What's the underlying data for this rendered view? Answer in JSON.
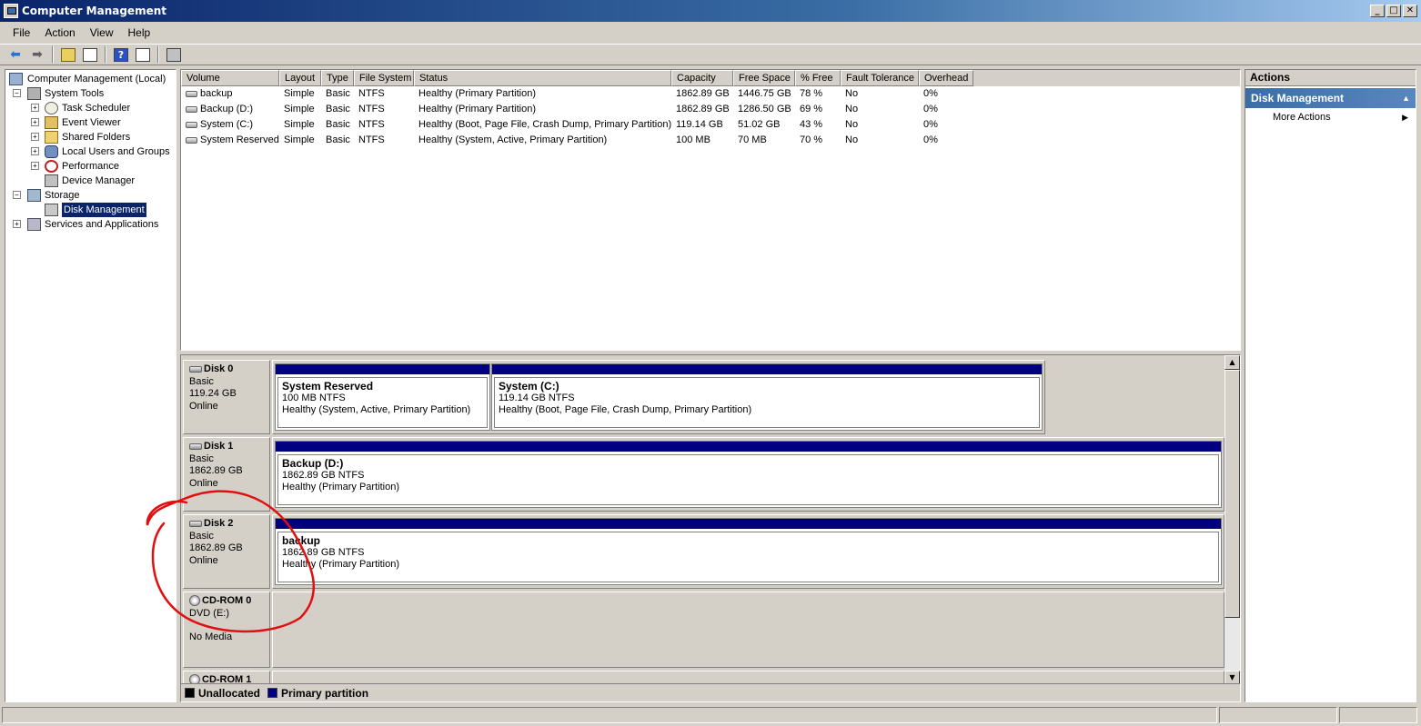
{
  "window": {
    "title": "Computer Management",
    "minimize": "_",
    "maximize": "□",
    "close": "✕"
  },
  "menu": [
    {
      "label": "File",
      "name": "file"
    },
    {
      "label": "Action",
      "name": "action"
    },
    {
      "label": "View",
      "name": "view"
    },
    {
      "label": "Help",
      "name": "help"
    }
  ],
  "tree": {
    "root": "Computer Management (Local)",
    "system_tools": "System Tools",
    "task_scheduler": "Task Scheduler",
    "event_viewer": "Event Viewer",
    "shared_folders": "Shared Folders",
    "local_users": "Local Users and Groups",
    "performance": "Performance",
    "device_manager": "Device Manager",
    "storage": "Storage",
    "disk_management": "Disk Management",
    "services": "Services and Applications"
  },
  "volume_list": {
    "columns": [
      "Volume",
      "Layout",
      "Type",
      "File System",
      "Status",
      "Capacity",
      "Free Space",
      "% Free",
      "Fault Tolerance",
      "Overhead"
    ],
    "rows": [
      [
        "backup",
        "Simple",
        "Basic",
        "NTFS",
        "Healthy (Primary Partition)",
        "1862.89 GB",
        "1446.75 GB",
        "78 %",
        "No",
        "0%"
      ],
      [
        "Backup (D:)",
        "Simple",
        "Basic",
        "NTFS",
        "Healthy (Primary Partition)",
        "1862.89 GB",
        "1286.50 GB",
        "69 %",
        "No",
        "0%"
      ],
      [
        "System (C:)",
        "Simple",
        "Basic",
        "NTFS",
        "Healthy (Boot, Page File, Crash Dump, Primary Partition)",
        "119.14 GB",
        "51.02 GB",
        "43 %",
        "No",
        "0%"
      ],
      [
        "System Reserved",
        "Simple",
        "Basic",
        "NTFS",
        "Healthy (System, Active, Primary Partition)",
        "100 MB",
        "70 MB",
        "70 %",
        "No",
        "0%"
      ]
    ]
  },
  "disks": {
    "disk0": {
      "name": "Disk 0",
      "type": "Basic",
      "size": "119.24 GB",
      "status": "Online",
      "p1": {
        "name": "System Reserved",
        "size": "100 MB NTFS",
        "status": "Healthy (System, Active, Primary Partition)"
      },
      "p2": {
        "name": "System  (C:)",
        "size": "119.14 GB NTFS",
        "status": "Healthy (Boot, Page File, Crash Dump, Primary Partition)"
      }
    },
    "disk1": {
      "name": "Disk 1",
      "type": "Basic",
      "size": "1862.89 GB",
      "status": "Online",
      "p1": {
        "name": "Backup  (D:)",
        "size": "1862.89 GB NTFS",
        "status": "Healthy (Primary Partition)"
      }
    },
    "disk2": {
      "name": "Disk 2",
      "type": "Basic",
      "size": "1862.89 GB",
      "status": "Online",
      "p1": {
        "name": "backup",
        "size": "1862.89 GB NTFS",
        "status": "Healthy (Primary Partition)"
      }
    },
    "cdrom0": {
      "name": "CD-ROM 0",
      "drive": "DVD (E:)",
      "media": "No Media"
    },
    "cdrom1": {
      "name": "CD-ROM 1"
    }
  },
  "legend": {
    "unallocated": "Unallocated",
    "primary": "Primary partition",
    "unallocated_color": "#000000",
    "primary_color": "#000080"
  },
  "actions": {
    "header": "Actions",
    "section": "Disk Management",
    "more_actions": "More Actions"
  },
  "colors": {
    "partition_bar": "#000080",
    "selection": "#0a246a",
    "annotation": "#e01010"
  }
}
